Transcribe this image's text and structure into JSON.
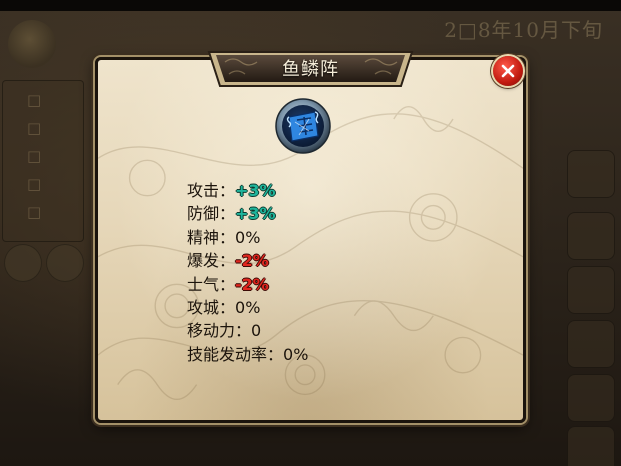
{
  "background": {
    "date": "2□8年10月下旬",
    "menu": [
      "□",
      "□",
      "□",
      "□",
      "□"
    ]
  },
  "dialog": {
    "title": "鱼鳞阵",
    "close_icon": "close-x-icon",
    "formation_icon": "scroll-formation-icon",
    "stats": [
      {
        "label": "攻击：",
        "value": "+3%",
        "type": "pos"
      },
      {
        "label": "防御：",
        "value": "+3%",
        "type": "pos"
      },
      {
        "label": "精神：",
        "value": "0%",
        "type": "neutral"
      },
      {
        "label": "爆发：",
        "value": "-2%",
        "type": "neg"
      },
      {
        "label": "士气：",
        "value": "-2%",
        "type": "neg"
      },
      {
        "label": "攻城：",
        "value": "0%",
        "type": "neutral"
      },
      {
        "label": "移动力：",
        "value": "0",
        "type": "neutral"
      },
      {
        "label": "技能发动率：",
        "value": "0%",
        "type": "neutral"
      }
    ]
  },
  "colors": {
    "positive": "#1fb59c",
    "negative": "#e0271f",
    "text": "#1c140c",
    "parchment": "#e6d7b9"
  }
}
